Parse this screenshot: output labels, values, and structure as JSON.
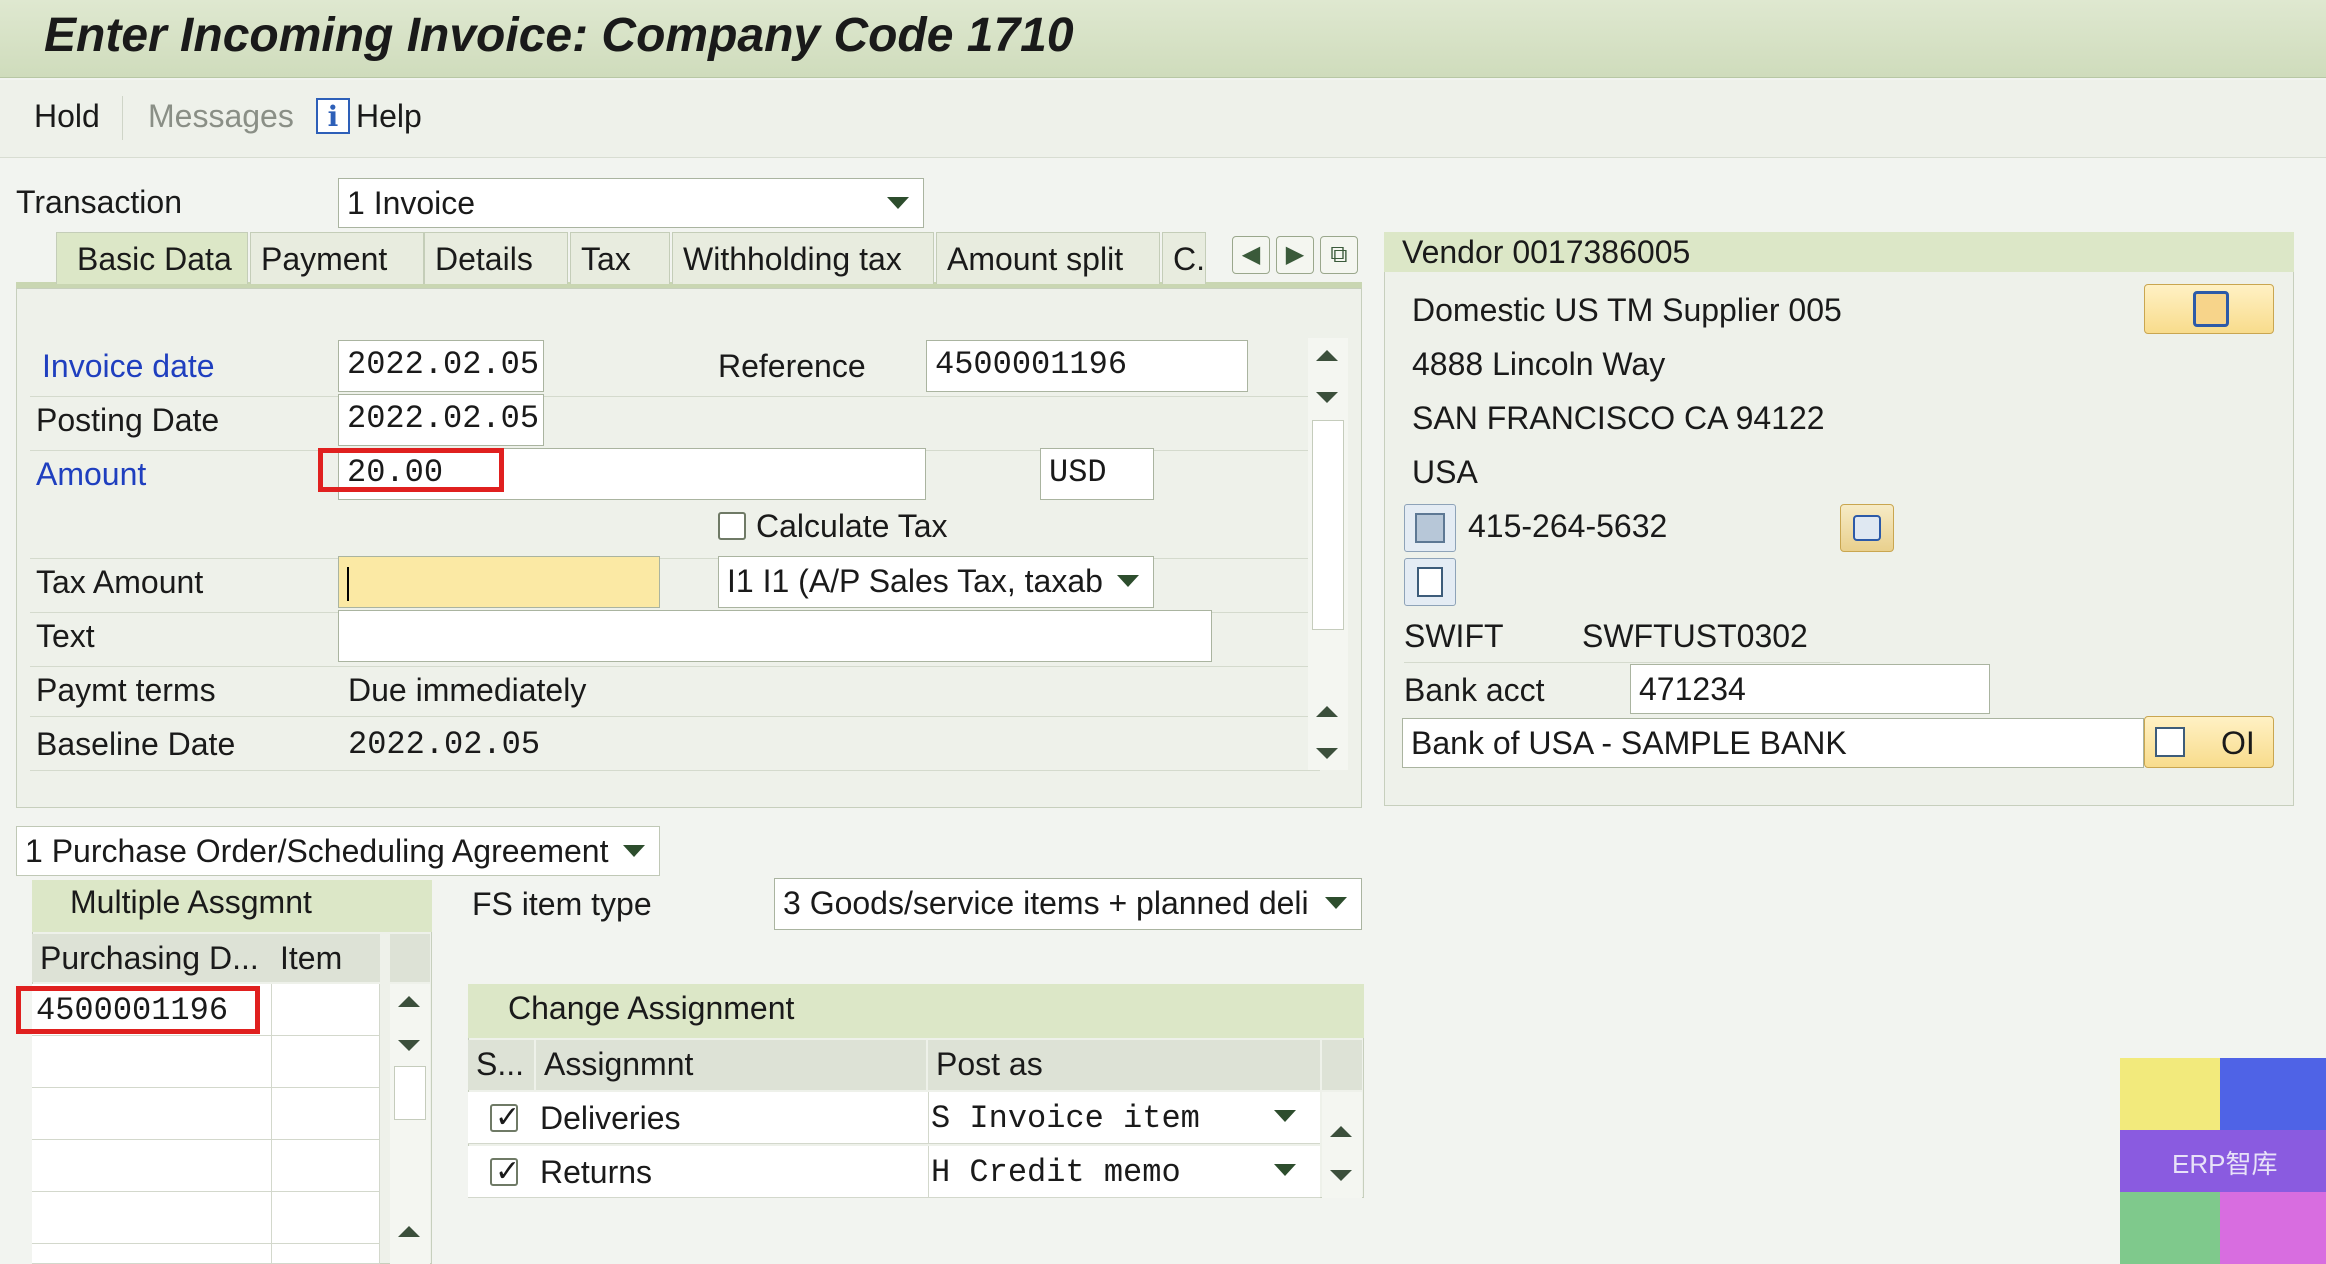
{
  "window": {
    "title": "Enter Incoming Invoice: Company Code 1710"
  },
  "toolbar": {
    "hold": "Hold",
    "messages": "Messages",
    "help": "Help"
  },
  "transaction": {
    "label": "Transaction",
    "value": "1 Invoice"
  },
  "tabs": [
    "Basic Data",
    "Payment",
    "Details",
    "Tax",
    "Withholding tax",
    "Amount split",
    "C."
  ],
  "basic": {
    "invoice_date_label": "Invoice date",
    "invoice_date": "2022.02.05",
    "posting_date_label": "Posting Date",
    "posting_date": "2022.02.05",
    "amount_label": "Amount",
    "amount": "20.00",
    "currency": "USD",
    "reference_label": "Reference",
    "reference": "4500001196",
    "calc_tax_label": "Calculate Tax",
    "tax_amount_label": "Tax Amount",
    "tax_amount": "",
    "tax_code": "I1 I1 (A/P Sales Tax, taxab",
    "text_label": "Text",
    "text": "",
    "paymt_terms_label": "Paymt terms",
    "paymt_terms": "Due immediately",
    "baseline_label": "Baseline Date",
    "baseline": "2022.02.05"
  },
  "vendor": {
    "header": "Vendor 0017386005",
    "name": "Domestic US TM Supplier 005",
    "street": "4888 Lincoln Way",
    "city": "SAN FRANCISCO CA  94122",
    "country": "USA",
    "phone": "415-264-5632",
    "swift_label": "SWIFT",
    "swift": "SWFTUST0302",
    "bank_acct_label": "Bank acct",
    "bank_acct": "471234",
    "bank_name": "Bank of USA - SAMPLE BANK",
    "oi_label": "OI"
  },
  "reference_doc": {
    "type": "1 Purchase Order/Scheduling Agreement",
    "multiple_assgmt": "Multiple Assgmnt",
    "col_purchasing": "Purchasing D...",
    "col_item": "Item",
    "rows": [
      "4500001196"
    ],
    "fs_item_type_label": "FS item type",
    "fs_item_type": "3 Goods/service items + planned deli"
  },
  "change_assignment": {
    "title": "Change Assignment",
    "col_s": "S...",
    "col_assignment": "Assignmnt",
    "col_post_as": "Post as",
    "rows": [
      {
        "assignment": "Deliveries",
        "post_as": "S Invoice item",
        "checked": true
      },
      {
        "assignment": "Returns",
        "post_as": "H Credit memo",
        "checked": true
      }
    ]
  },
  "watermark": {
    "text": "ERP智库"
  }
}
